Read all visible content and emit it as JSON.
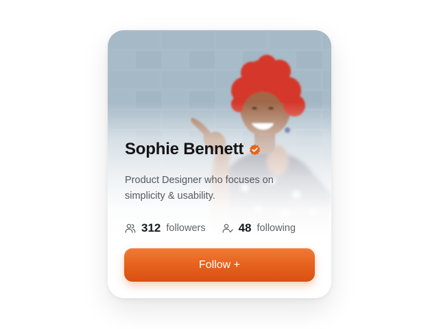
{
  "profile": {
    "name": "Sophie Bennett",
    "bio": "Product Designer who focuses on simplicity & usability.",
    "verified": true,
    "photo_icon": "portrait-photo"
  },
  "stats": {
    "followers": {
      "count": "312",
      "label": "followers",
      "icon": "users-icon"
    },
    "following": {
      "count": "48",
      "label": "following",
      "icon": "user-check-icon"
    }
  },
  "actions": {
    "follow_label": "Follow +"
  },
  "colors": {
    "accent": "#e8651f",
    "accent_dark": "#d85112",
    "name_text": "#141414",
    "muted_text": "#55585e",
    "wall": "#9ab0bf",
    "hair": "#d5372b"
  }
}
